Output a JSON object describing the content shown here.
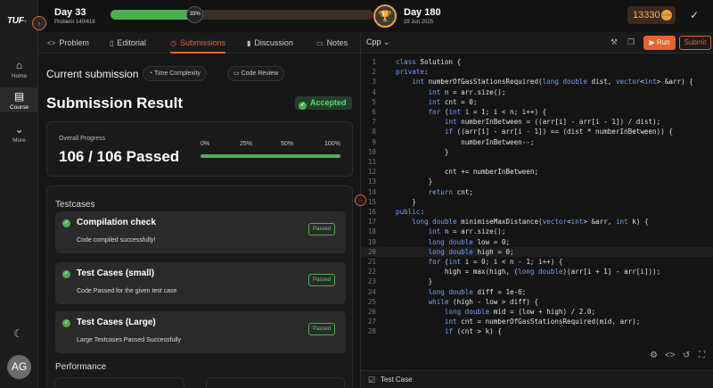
{
  "topbar": {
    "day_start": "Day 33",
    "problem_count": "Problem 140/418",
    "progress_percent": 33,
    "progress_label": "33%",
    "day_end": "Day 180",
    "end_date": "29 Jun 2025",
    "coins": "13330",
    "coin_badge": "COIN"
  },
  "sidebar": {
    "logo": "TUF",
    "logo_plus": "+",
    "items": [
      {
        "label": "Home",
        "icon": "home-icon"
      },
      {
        "label": "Course",
        "icon": "book-icon"
      },
      {
        "label": "More",
        "icon": "chevron-down-icon"
      }
    ],
    "avatar": "AG"
  },
  "tabs": [
    {
      "label": "Problem",
      "icon": "code-icon"
    },
    {
      "label": "Editorial",
      "icon": "document-icon"
    },
    {
      "label": "Submissions",
      "icon": "clock-icon"
    },
    {
      "label": "Discussion",
      "icon": "chart-icon"
    },
    {
      "label": "Notes",
      "icon": "folder-icon"
    }
  ],
  "submission": {
    "current_label": "Current submission",
    "time_complexity": "Time Complexity",
    "code_review": "Code Review",
    "result_title": "Submission Result",
    "status": "Accepted",
    "overall_label": "Overall Progress",
    "passed_text": "106 / 106 Passed",
    "progress_ticks": [
      "0%",
      "25%",
      "50%",
      "100%"
    ],
    "progress_value": 1.0
  },
  "testcases": {
    "title": "Testcases",
    "items": [
      {
        "name": "Compilation check",
        "desc": "Code compiled successfully!",
        "status": "Passed"
      },
      {
        "name": "Test Cases (small)",
        "desc": "Code Passed for the given test case",
        "status": "Passed"
      },
      {
        "name": "Test Cases (Large)",
        "desc": "Large Testcases Passed Successfully",
        "status": "Passed"
      }
    ]
  },
  "performance": {
    "title": "Performance"
  },
  "editor": {
    "language": "Cpp",
    "run": "Run",
    "submit": "Submit",
    "current_line": 20,
    "lines": [
      "class Solution {",
      "private:",
      "    int numberOfGasStationsRequired(long double dist, vector<int> &arr) {",
      "        int n = arr.size();",
      "        int cnt = 0;",
      "        for (int i = 1; i < n; i++) {",
      "            int numberInBetween = ((arr[i] - arr[i - 1]) / dist);",
      "            if ((arr[i] - arr[i - 1]) == (dist * numberInBetween)) {",
      "                numberInBetween--;",
      "            }",
      "",
      "            cnt += numberInBetween;",
      "        }",
      "        return cnt;",
      "    }",
      "public:",
      "    long double minimiseMaxDistance(vector<int> &arr, int k) {",
      "        int n = arr.size();",
      "        long double low = 0;",
      "        long double high = 0;",
      "        for (int i = 0; i < n - 1; i++) {",
      "            high = max(high, (long double)(arr[i + 1] - arr[i]));",
      "        }",
      "        long double diff = 1e-6;",
      "        while (high - low > diff) {",
      "            long double mid = (low + high) / 2.0;",
      "            int cnt = numberOfGasStationsRequired(mid, arr);",
      "            if (cnt > k) {"
    ],
    "testcase_label": "Test Case"
  }
}
